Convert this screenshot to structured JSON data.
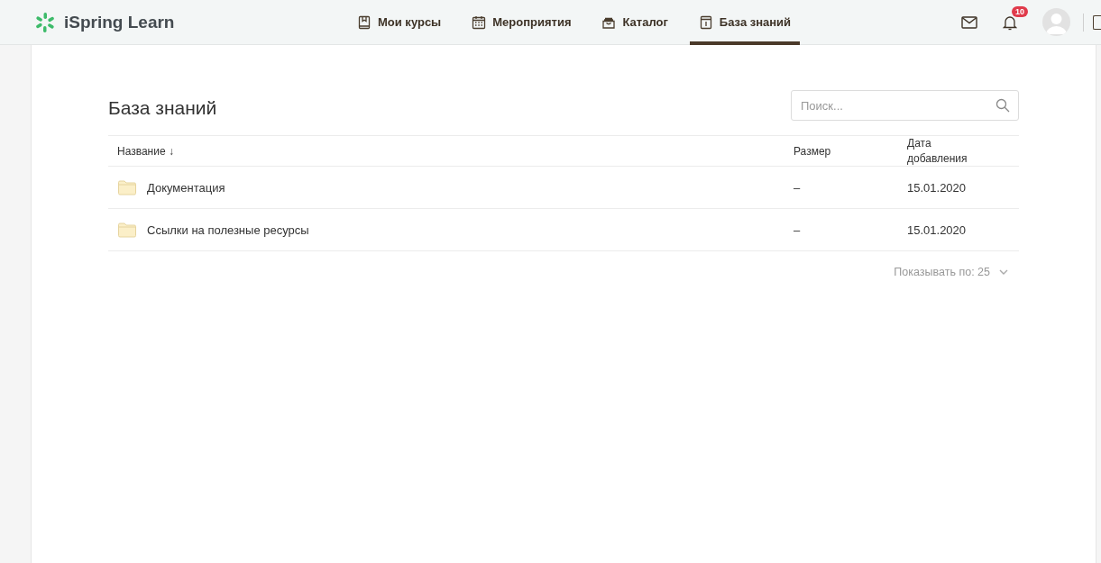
{
  "header": {
    "logo": "iSpring Learn",
    "nav": [
      {
        "label": "Мои курсы",
        "selected": false
      },
      {
        "label": "Мероприятия",
        "selected": false
      },
      {
        "label": "Каталог",
        "selected": false
      },
      {
        "label": "База знаний",
        "selected": true
      }
    ],
    "notifications_badge": "10"
  },
  "page": {
    "title": "База знаний",
    "search": {
      "placeholder": "Поиск..."
    },
    "table": {
      "columns": [
        "Название ↓",
        "Размер",
        "Дата добавления"
      ],
      "rows": [
        {
          "name": "Документация",
          "size": "–",
          "date": "15.01.2020"
        },
        {
          "name": "Ссылки на полезные ресурсы",
          "size": "–",
          "date": "15.01.2020"
        }
      ]
    },
    "page_size": "Показывать по: 25"
  }
}
